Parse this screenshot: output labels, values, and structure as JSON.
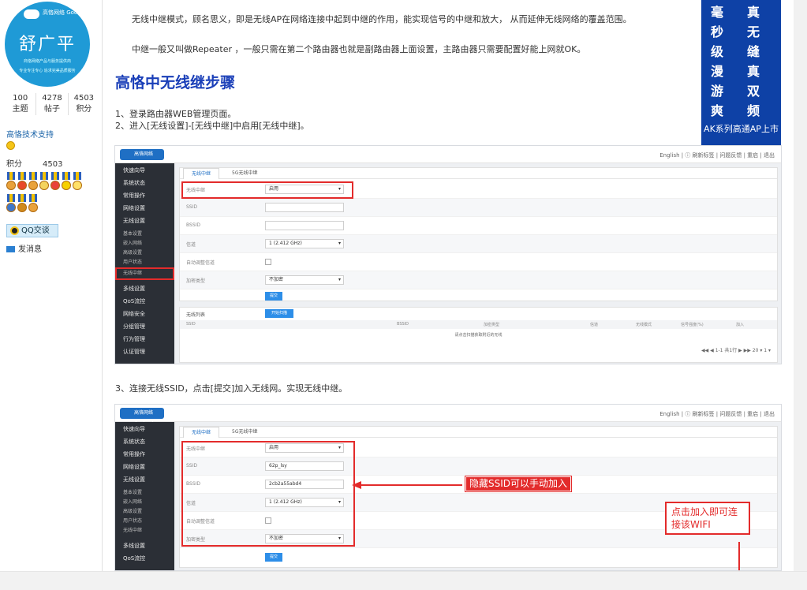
{
  "profile": {
    "avatar_brand": "高恪网络 Gocloud",
    "avatar_name": "舒广平",
    "avatar_tag1": "商恪网络产品与服务提供商",
    "avatar_tag2": "专业专注专心 追求完美品质服务",
    "stats": [
      {
        "value": "100",
        "label": "主题"
      },
      {
        "value": "4278",
        "label": "帖子"
      },
      {
        "value": "4503",
        "label": "积分"
      }
    ],
    "group": "高恪技术支持",
    "points_label": "积分",
    "points_value": "4503",
    "qq_label": "QQ交谈",
    "message_label": "发消息"
  },
  "article": {
    "p1": "无线中继模式，顾名思义，即是无线AP在网络连接中起到中继的作用，能实现信号的中继和放大， 从而延伸无线网络的覆盖范围。",
    "p2": "中继一般又叫做Repeater ，一般只需在第二个路由器也就是副路由器上面设置，主路由器只需要配置好能上网就OK。",
    "heading": "高恪中无线继步骤",
    "step1": "1、登录路由器WEB管理页面。",
    "step2": "2、进入[无线设置]-[无线中继]中启用[无线中继]。",
    "step3": "3、连接无线SSID，点击[提交]加入无线网。实现无线中继。"
  },
  "ad": {
    "col1": [
      "毫",
      "秒",
      "级",
      "漫",
      "游",
      "爽"
    ],
    "col2": [
      "真",
      "无",
      "缝",
      "真",
      "双",
      "频"
    ],
    "footer": "AK系列高通AP上市"
  },
  "screenshot1": {
    "brand": "高恪网络 Gocloud",
    "toplinks": "English  |  ⓘ 刷新标签  |  问题反馈  |  重启  |  退出",
    "sidebar": [
      "快速向导",
      "系统状态",
      "常用操作",
      "网络设置",
      "无线设置"
    ],
    "sidebar_sub": [
      "基本设置",
      "嵌入网络",
      "高级设置",
      "用户状态",
      "无线中继"
    ],
    "sidebar_after": [
      "多线设置",
      "QoS流控",
      "网络安全",
      "分组管理",
      "行为管理",
      "认证管理"
    ],
    "tabs": [
      "无线中继",
      "5G无线中继"
    ],
    "fields": [
      {
        "label": "无线中继",
        "value": "启用",
        "kind": "select"
      },
      {
        "label": "SSID",
        "value": "",
        "kind": "input"
      },
      {
        "label": "BSSID",
        "value": "",
        "kind": "input"
      },
      {
        "label": "信道",
        "value": "1 (2.412 GHz)",
        "kind": "select"
      },
      {
        "label": "自动调整信道",
        "value": "",
        "kind": "check"
      },
      {
        "label": "加密类型",
        "value": "不加密",
        "kind": "select"
      }
    ],
    "submit_label": "提交",
    "list_title": "无线列表",
    "scan_label": "开始扫描",
    "list_headers": [
      "SSID",
      "BSSID",
      "加密类型",
      "信道",
      "无线模式",
      "信号强度(%)",
      "加入"
    ],
    "list_empty": "请点击扫描获取附近的无线",
    "pager": "◀◀ ◀ 1-1 共1行 ▶ ▶▶   20 ▾   1 ▾"
  },
  "screenshot2": {
    "fields": [
      {
        "label": "无线中继",
        "value": "启用",
        "kind": "select"
      },
      {
        "label": "SSID",
        "value": "62p_lsy",
        "kind": "input"
      },
      {
        "label": "BSSID",
        "value": "2cb2a55abd4",
        "kind": "input"
      },
      {
        "label": "信道",
        "value": "1 (2.412 GHz)",
        "kind": "select"
      },
      {
        "label": "自动调整信道",
        "value": "",
        "kind": "check"
      },
      {
        "label": "加密类型",
        "value": "不加密",
        "kind": "select"
      }
    ],
    "annotation1": "隐藏SSID可以手动加入",
    "annotation2_line1": "点击加入即可连",
    "annotation2_line2": "接该WIFI"
  },
  "colors": {
    "accent": "#1a3fb8",
    "annotation_red": "#e32b2b",
    "router_sidebar": "#2b2f36",
    "ad_bg": "#0e41a6"
  }
}
